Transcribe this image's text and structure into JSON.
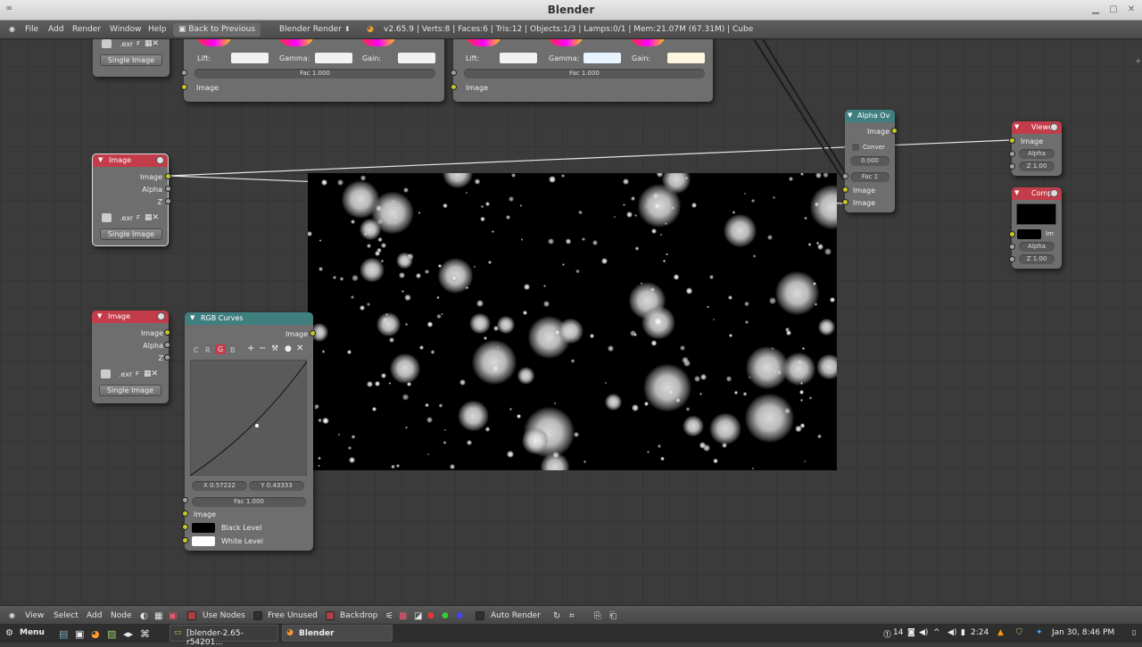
{
  "window": {
    "title": "Blender"
  },
  "menubar": {
    "items": [
      "File",
      "Add",
      "Render",
      "Window",
      "Help"
    ],
    "back": "Back to Previous",
    "engine": "Blender Render",
    "stats": "v2.65.9 | Verts:8 | Faces:6 | Tris:12 | Objects:1/3 | Lamps:0/1 | Mem:21.07M (67.31M) | Cube"
  },
  "cb_left": {
    "lift": "Lift:",
    "gamma": "Gamma:",
    "gain": "Gain:",
    "fac": "Fac 1.000",
    "out": "Image"
  },
  "cb_right": {
    "lift": "Lift:",
    "gamma": "Gamma:",
    "gain": "Gain:",
    "fac": "Fac 1.000",
    "out": "Image"
  },
  "top_image_stub": {
    "file": ".exr",
    "f": "F",
    "mode": "Single Image"
  },
  "image1": {
    "title": "Image",
    "out_image": "Image",
    "out_alpha": "Alpha",
    "out_z": "Z",
    "file": ".exr",
    "f": "F",
    "mode": "Single Image"
  },
  "image2": {
    "title": "Image",
    "out_image": "Image",
    "out_alpha": "Alpha",
    "out_z": "Z",
    "file": ".exr",
    "f": "F",
    "mode": "Single Image"
  },
  "curves": {
    "title": "RGB Curves",
    "out": "Image",
    "channels": [
      "C",
      "R",
      "G",
      "B"
    ],
    "x": "X 0.57222",
    "y": "Y 0.43333",
    "fac": "Fac 1.000",
    "in_image": "Image",
    "black": "Black Level",
    "white": "White Level"
  },
  "alpha_over": {
    "title": "Alpha Ov",
    "out": "Image",
    "convert": "Conver",
    "value": "0.000",
    "fac": "Fac 1",
    "in1": "Image",
    "in2": "Image"
  },
  "viewer": {
    "title": "Viewe",
    "image": "Image",
    "alpha": "Alpha",
    "z": "Z 1.00"
  },
  "composite": {
    "title": "Comp",
    "im": "Im",
    "alpha": "Alpha",
    "z": "Z 1.00"
  },
  "footer": {
    "view": "View",
    "select": "Select",
    "add": "Add",
    "node": "Node",
    "use_nodes": "Use Nodes",
    "free_unused": "Free Unused",
    "backdrop": "Backdrop",
    "auto_render": "Auto Render"
  },
  "taskbar": {
    "menu": "Menu",
    "task1": "[blender-2.65-r54201...",
    "task2": "Blender",
    "tray_num": "14",
    "time_small": "2:24",
    "datetime": "Jan 30,  8:46 PM"
  },
  "colors": {
    "node_red": "#c33c4a",
    "node_teal": "#3f7f80",
    "socket_yellow": "#c7c729",
    "socket_gray": "#a1a1a1"
  }
}
